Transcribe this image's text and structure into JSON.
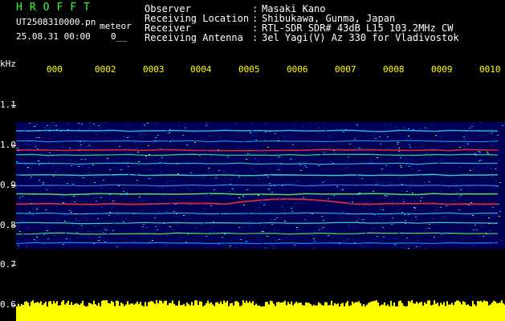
{
  "header": {
    "station": "HROFFT",
    "filename": "UT2508310000.pn",
    "mode": "meteor",
    "date": "25.08.31 00:00",
    "counter": "0__",
    "labels": {
      "observer": "Observer",
      "location": "Receiving Location",
      "receiver": "Receiver",
      "antenna": "Receiving Antenna"
    },
    "colon": ":",
    "values": {
      "observer": "Masaki Kano",
      "location": "Shibukawa, Gunma, Japan",
      "receiver": "RTL-SDR SDR# 43dB L15 103.2MHz CW",
      "antenna": "3el Yagi(V) Az 330 for Vladivostok"
    }
  },
  "axis": {
    "unit": "kHz",
    "y_ticks": [
      "1.1",
      "1.0",
      "0.9",
      "0.8",
      "0.7",
      "0.6"
    ],
    "x_ticks": [
      "000",
      "0002",
      "0003",
      "0004",
      "0005",
      "0006",
      "0007",
      "0008",
      "0009",
      "0010"
    ]
  },
  "colors": {
    "background": "#000000",
    "header_text": "#ffffff",
    "station_text": "#33ff33",
    "time_labels": "#ffff00",
    "amplitude_bar": "#ffff00",
    "spectrogram_low": "#0000aa",
    "spectrogram_mid": "#00ffff",
    "spectrogram_high": "#ff3333"
  }
}
